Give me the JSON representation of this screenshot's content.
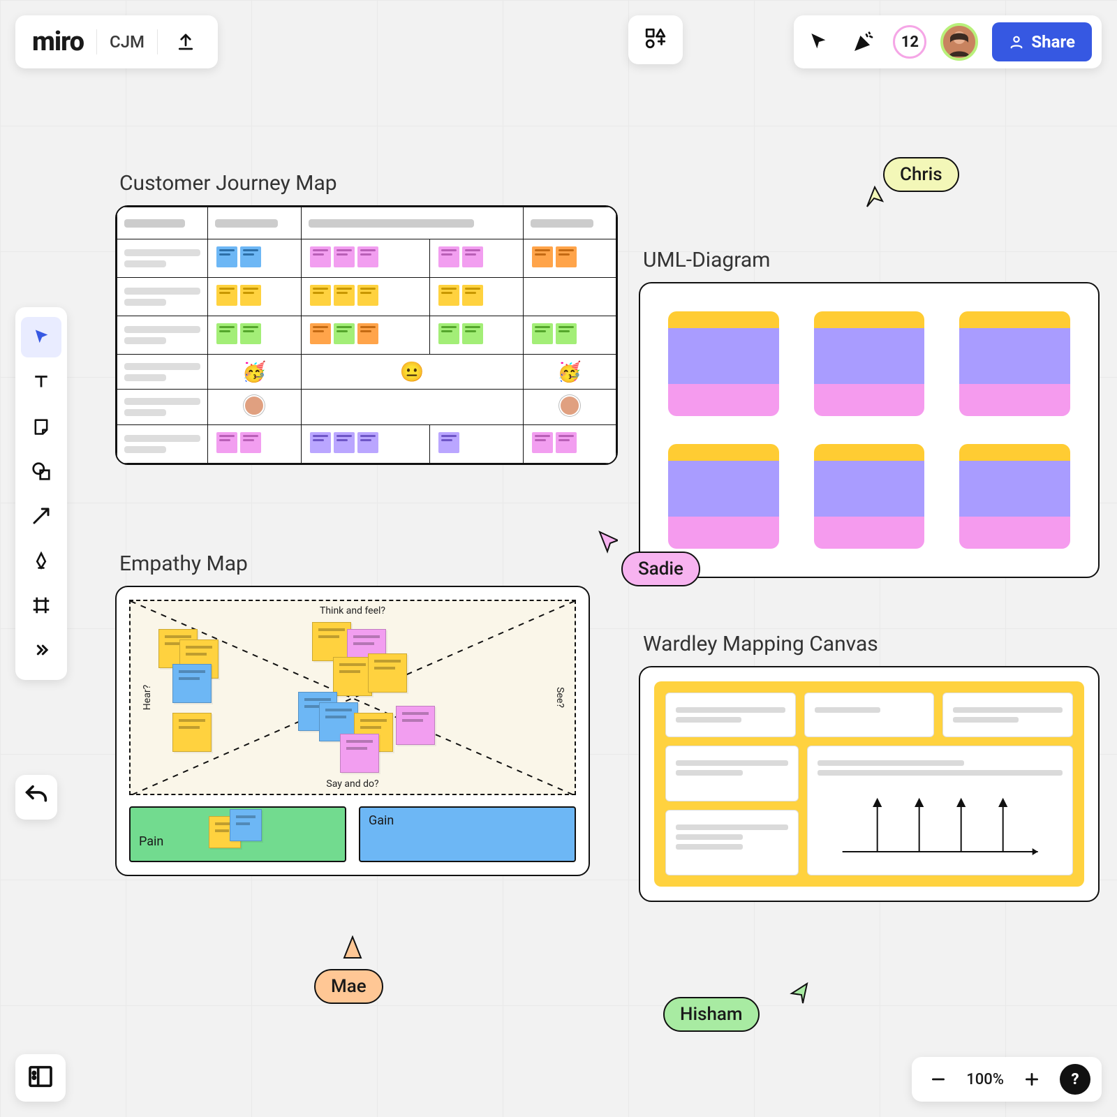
{
  "app": {
    "logo": "miro",
    "board_name": "CJM"
  },
  "topRight": {
    "collaborator_count": "12",
    "share_label": "Share"
  },
  "zoom": {
    "value": "100%"
  },
  "panels": {
    "cjm_title": "Customer Journey Map",
    "uml_title": "UML-Diagram",
    "emp_title": "Empathy Map",
    "ward_title": "Wardley Mapping Canvas"
  },
  "empathy": {
    "top": "Think and feel?",
    "bottom": "Say and do?",
    "left": "Hear?",
    "right": "See?",
    "pain": "Pain",
    "gain": "Gain"
  },
  "cursors": {
    "chris": "Chris",
    "sadie": "Sadie",
    "mae": "Mae",
    "hisham": "Hisham"
  },
  "help_label": "?"
}
